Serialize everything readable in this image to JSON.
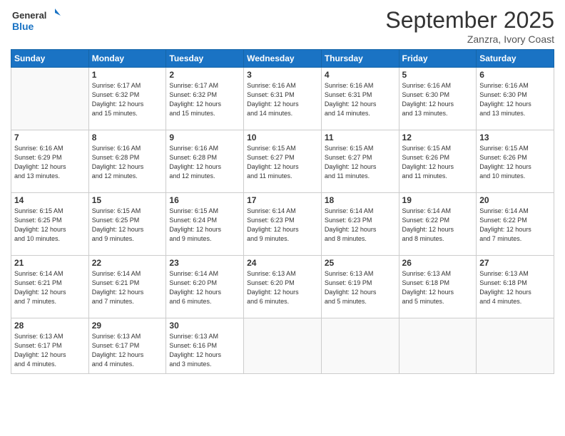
{
  "logo": {
    "line1": "General",
    "line2": "Blue"
  },
  "title": "September 2025",
  "location": "Zanzra, Ivory Coast",
  "days_of_week": [
    "Sunday",
    "Monday",
    "Tuesday",
    "Wednesday",
    "Thursday",
    "Friday",
    "Saturday"
  ],
  "weeks": [
    [
      {
        "day": "",
        "info": ""
      },
      {
        "day": "1",
        "info": "Sunrise: 6:17 AM\nSunset: 6:32 PM\nDaylight: 12 hours\nand 15 minutes."
      },
      {
        "day": "2",
        "info": "Sunrise: 6:17 AM\nSunset: 6:32 PM\nDaylight: 12 hours\nand 15 minutes."
      },
      {
        "day": "3",
        "info": "Sunrise: 6:16 AM\nSunset: 6:31 PM\nDaylight: 12 hours\nand 14 minutes."
      },
      {
        "day": "4",
        "info": "Sunrise: 6:16 AM\nSunset: 6:31 PM\nDaylight: 12 hours\nand 14 minutes."
      },
      {
        "day": "5",
        "info": "Sunrise: 6:16 AM\nSunset: 6:30 PM\nDaylight: 12 hours\nand 13 minutes."
      },
      {
        "day": "6",
        "info": "Sunrise: 6:16 AM\nSunset: 6:30 PM\nDaylight: 12 hours\nand 13 minutes."
      }
    ],
    [
      {
        "day": "7",
        "info": "Sunrise: 6:16 AM\nSunset: 6:29 PM\nDaylight: 12 hours\nand 13 minutes."
      },
      {
        "day": "8",
        "info": "Sunrise: 6:16 AM\nSunset: 6:28 PM\nDaylight: 12 hours\nand 12 minutes."
      },
      {
        "day": "9",
        "info": "Sunrise: 6:16 AM\nSunset: 6:28 PM\nDaylight: 12 hours\nand 12 minutes."
      },
      {
        "day": "10",
        "info": "Sunrise: 6:15 AM\nSunset: 6:27 PM\nDaylight: 12 hours\nand 11 minutes."
      },
      {
        "day": "11",
        "info": "Sunrise: 6:15 AM\nSunset: 6:27 PM\nDaylight: 12 hours\nand 11 minutes."
      },
      {
        "day": "12",
        "info": "Sunrise: 6:15 AM\nSunset: 6:26 PM\nDaylight: 12 hours\nand 11 minutes."
      },
      {
        "day": "13",
        "info": "Sunrise: 6:15 AM\nSunset: 6:26 PM\nDaylight: 12 hours\nand 10 minutes."
      }
    ],
    [
      {
        "day": "14",
        "info": "Sunrise: 6:15 AM\nSunset: 6:25 PM\nDaylight: 12 hours\nand 10 minutes."
      },
      {
        "day": "15",
        "info": "Sunrise: 6:15 AM\nSunset: 6:25 PM\nDaylight: 12 hours\nand 9 minutes."
      },
      {
        "day": "16",
        "info": "Sunrise: 6:15 AM\nSunset: 6:24 PM\nDaylight: 12 hours\nand 9 minutes."
      },
      {
        "day": "17",
        "info": "Sunrise: 6:14 AM\nSunset: 6:23 PM\nDaylight: 12 hours\nand 9 minutes."
      },
      {
        "day": "18",
        "info": "Sunrise: 6:14 AM\nSunset: 6:23 PM\nDaylight: 12 hours\nand 8 minutes."
      },
      {
        "day": "19",
        "info": "Sunrise: 6:14 AM\nSunset: 6:22 PM\nDaylight: 12 hours\nand 8 minutes."
      },
      {
        "day": "20",
        "info": "Sunrise: 6:14 AM\nSunset: 6:22 PM\nDaylight: 12 hours\nand 7 minutes."
      }
    ],
    [
      {
        "day": "21",
        "info": "Sunrise: 6:14 AM\nSunset: 6:21 PM\nDaylight: 12 hours\nand 7 minutes."
      },
      {
        "day": "22",
        "info": "Sunrise: 6:14 AM\nSunset: 6:21 PM\nDaylight: 12 hours\nand 7 minutes."
      },
      {
        "day": "23",
        "info": "Sunrise: 6:14 AM\nSunset: 6:20 PM\nDaylight: 12 hours\nand 6 minutes."
      },
      {
        "day": "24",
        "info": "Sunrise: 6:13 AM\nSunset: 6:20 PM\nDaylight: 12 hours\nand 6 minutes."
      },
      {
        "day": "25",
        "info": "Sunrise: 6:13 AM\nSunset: 6:19 PM\nDaylight: 12 hours\nand 5 minutes."
      },
      {
        "day": "26",
        "info": "Sunrise: 6:13 AM\nSunset: 6:18 PM\nDaylight: 12 hours\nand 5 minutes."
      },
      {
        "day": "27",
        "info": "Sunrise: 6:13 AM\nSunset: 6:18 PM\nDaylight: 12 hours\nand 4 minutes."
      }
    ],
    [
      {
        "day": "28",
        "info": "Sunrise: 6:13 AM\nSunset: 6:17 PM\nDaylight: 12 hours\nand 4 minutes."
      },
      {
        "day": "29",
        "info": "Sunrise: 6:13 AM\nSunset: 6:17 PM\nDaylight: 12 hours\nand 4 minutes."
      },
      {
        "day": "30",
        "info": "Sunrise: 6:13 AM\nSunset: 6:16 PM\nDaylight: 12 hours\nand 3 minutes."
      },
      {
        "day": "",
        "info": ""
      },
      {
        "day": "",
        "info": ""
      },
      {
        "day": "",
        "info": ""
      },
      {
        "day": "",
        "info": ""
      }
    ]
  ]
}
